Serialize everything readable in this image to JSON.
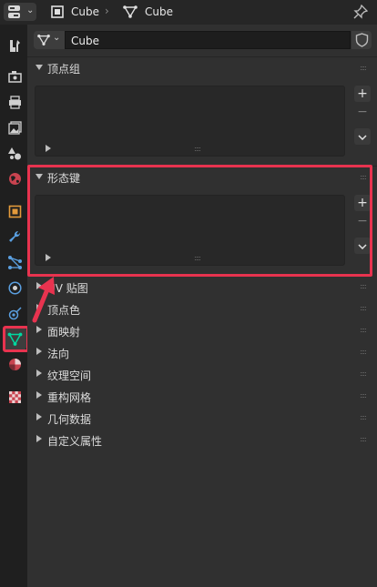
{
  "header": {
    "object_name": "Cube",
    "mesh_name": "Cube",
    "editor_caret": "⌄",
    "separator": "›"
  },
  "mesh_field": {
    "value": "Cube"
  },
  "vertex_groups": {
    "title": "顶点组"
  },
  "shape_keys": {
    "title": "形态键"
  },
  "panels": [
    {
      "label": "UV 贴图"
    },
    {
      "label": "顶点色"
    },
    {
      "label": "面映射"
    },
    {
      "label": "法向"
    },
    {
      "label": "纹理空间"
    },
    {
      "label": "重构网格"
    },
    {
      "label": "几何数据"
    },
    {
      "label": "自定义属性"
    }
  ],
  "buttons": {
    "add": "+",
    "remove": "−"
  },
  "grip": "::::",
  "colors": {
    "highlight": "#e8334f",
    "active_tab": "#00d8a0",
    "background": "#303030"
  }
}
